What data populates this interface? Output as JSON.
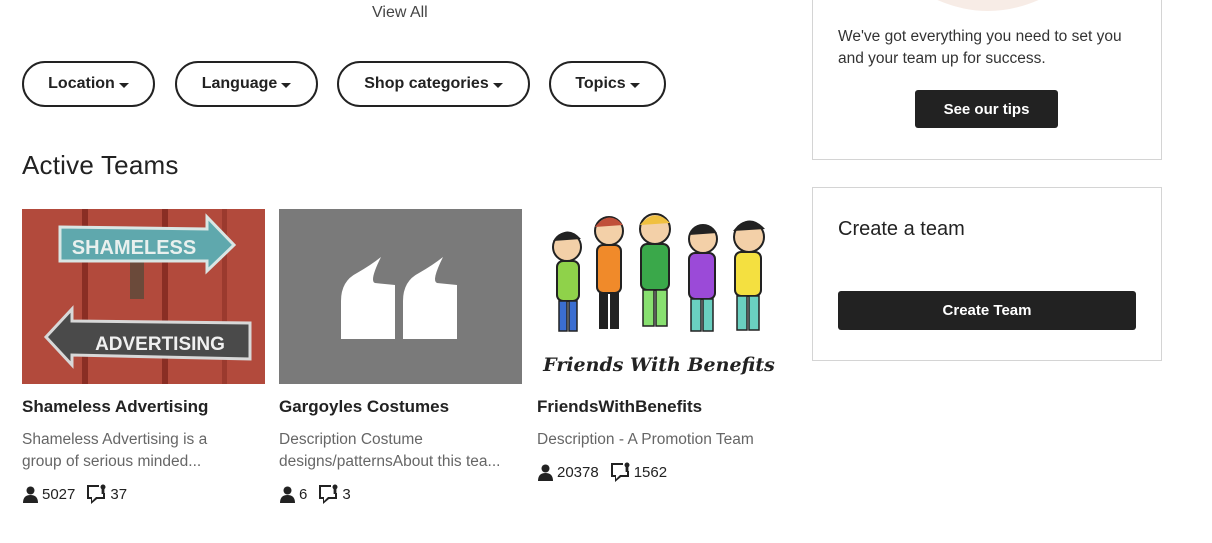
{
  "view_all_label": "View All",
  "filters": [
    {
      "label": "Location"
    },
    {
      "label": "Language"
    },
    {
      "label": "Shop categories"
    },
    {
      "label": "Topics"
    }
  ],
  "section_title": "Active Teams",
  "teams": [
    {
      "name": "Shameless Advertising",
      "description": "Shameless Advertising is a group of serious minded...",
      "members": "5027",
      "discussions": "37",
      "thumb_text_1": "SHAMELESS",
      "thumb_text_2": "ADVERTISING"
    },
    {
      "name": "Gargoyles Costumes",
      "description": "Description Costume designs/patternsAbout this tea...",
      "members": "6",
      "discussions": "3"
    },
    {
      "name": "FriendsWithBenefits",
      "description": "Description - A Promotion Team",
      "members": "20378",
      "discussions": "1562",
      "thumb_caption": "Friends With Benefits"
    }
  ],
  "tips_box": {
    "text": "We've got everything you need to set you and your team up for success.",
    "button_label": "See our tips"
  },
  "create_box": {
    "title": "Create a team",
    "button_label": "Create Team"
  },
  "colors": {
    "dark": "#222222",
    "muted": "#666666",
    "border": "#d4d4d4",
    "quote_bg": "#7a7a7a"
  }
}
